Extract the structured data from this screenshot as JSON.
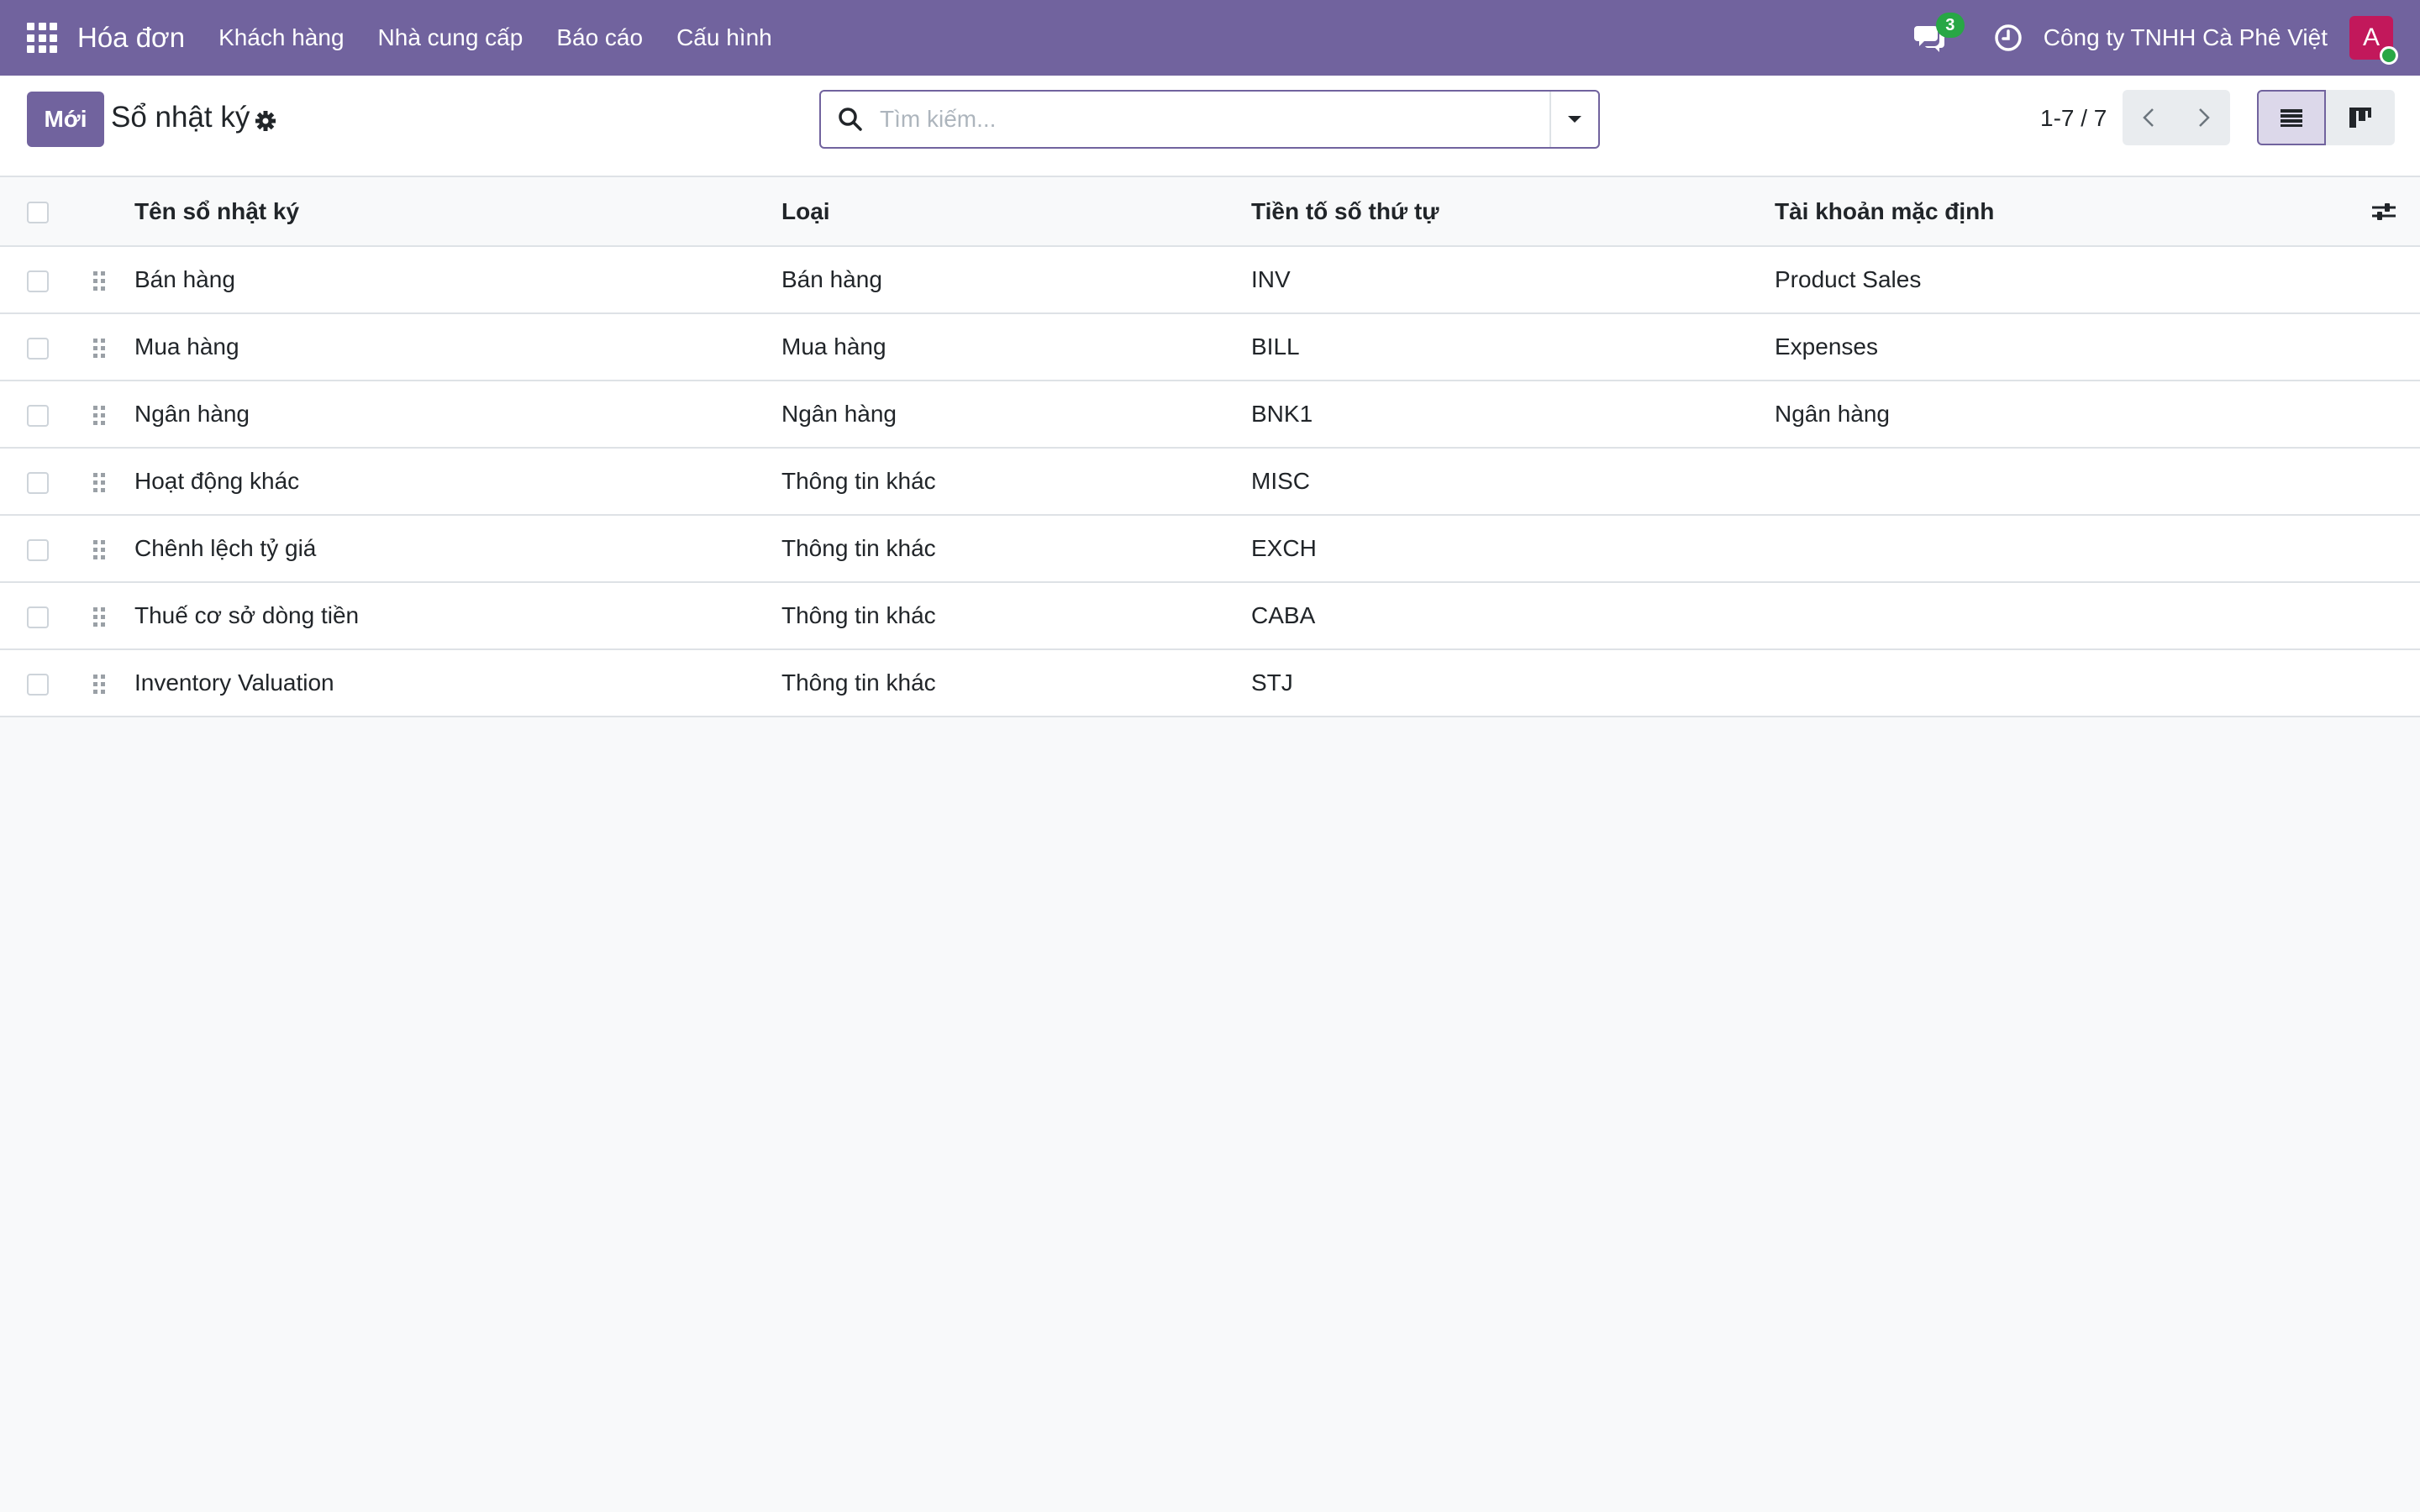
{
  "navbar": {
    "app_title": "Hóa đơn",
    "menu": [
      "Khách hàng",
      "Nhà cung cấp",
      "Báo cáo",
      "Cấu hình"
    ],
    "message_count": "3",
    "company": "Công ty TNHH Cà Phê Việt",
    "avatar_initial": "A",
    "avatar_color": "#c2185b",
    "brand_color": "#71639e"
  },
  "control_panel": {
    "new_label": "Mới",
    "title": "Sổ nhật ký",
    "search_placeholder": "Tìm kiếm...",
    "pager": "1-7 / 7"
  },
  "table": {
    "headers": [
      "Tên sổ nhật ký",
      "Loại",
      "Tiền tố số thứ tự",
      "Tài khoản mặc định"
    ],
    "rows": [
      {
        "name": "Bán hàng",
        "type": "Bán hàng",
        "prefix": "INV",
        "account": "Product Sales"
      },
      {
        "name": "Mua hàng",
        "type": "Mua hàng",
        "prefix": "BILL",
        "account": "Expenses"
      },
      {
        "name": "Ngân hàng",
        "type": "Ngân hàng",
        "prefix": "BNK1",
        "account": "Ngân hàng"
      },
      {
        "name": "Hoạt động khác",
        "type": "Thông tin khác",
        "prefix": "MISC",
        "account": ""
      },
      {
        "name": "Chênh lệch tỷ giá",
        "type": "Thông tin khác",
        "prefix": "EXCH",
        "account": ""
      },
      {
        "name": "Thuế cơ sở dòng tiền",
        "type": "Thông tin khác",
        "prefix": "CABA",
        "account": ""
      },
      {
        "name": "Inventory Valuation",
        "type": "Thông tin khác",
        "prefix": "STJ",
        "account": ""
      }
    ]
  }
}
